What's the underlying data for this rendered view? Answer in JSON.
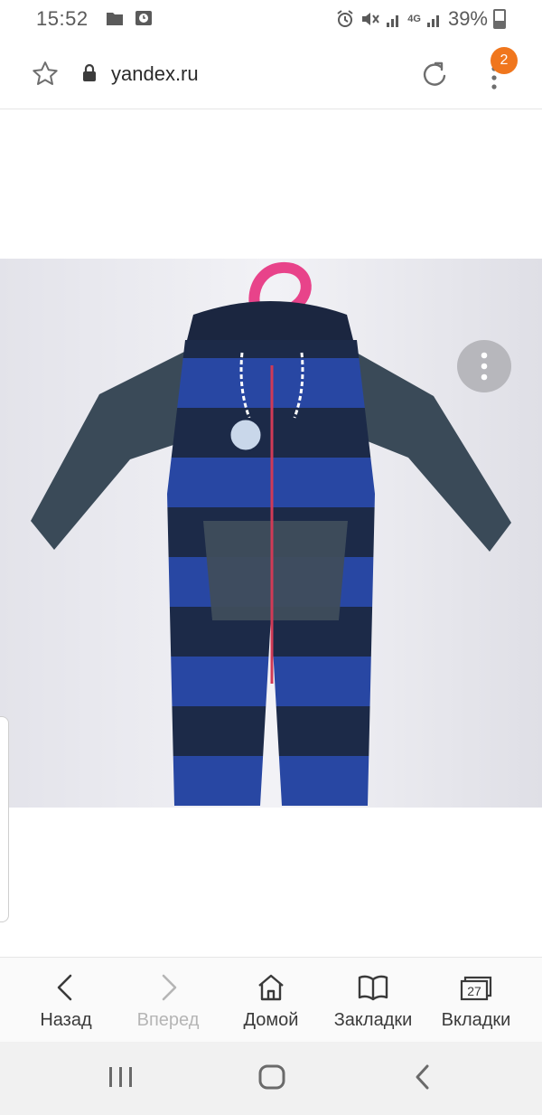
{
  "status_bar": {
    "time": "15:52",
    "signal_1": "4G",
    "battery": "39%"
  },
  "address_bar": {
    "url": "yandex.ru",
    "tabs_badge": "2"
  },
  "bottom_nav": {
    "items": [
      {
        "label": "Назад",
        "icon": "back-arrow-icon",
        "enabled": true
      },
      {
        "label": "Вперед",
        "icon": "forward-arrow-icon",
        "enabled": false
      },
      {
        "label": "Домой",
        "icon": "home-icon",
        "enabled": true
      },
      {
        "label": "Закладки",
        "icon": "bookmarks-icon",
        "enabled": true
      },
      {
        "label": "Вкладки",
        "icon": "tabs-icon",
        "enabled": true,
        "count": "27"
      }
    ]
  },
  "colors": {
    "accent_badge": "#f0761d",
    "photo_background": "#e9e9ee",
    "garment_navy": "#1e2b4a",
    "garment_blue": "#2a4aa8",
    "hanger_pink": "#e8438a"
  }
}
